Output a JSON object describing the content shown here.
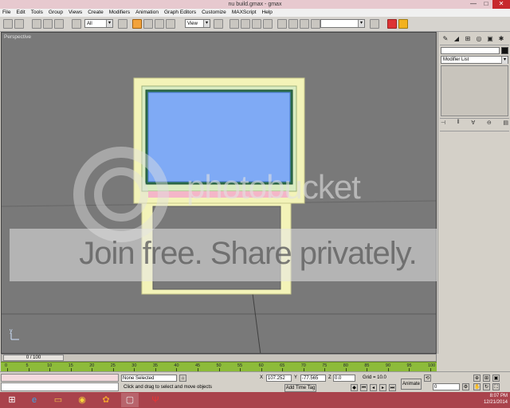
{
  "window": {
    "title": "nu build.gmax - gmax",
    "minimize_glyph": "—",
    "maximize_glyph": "□",
    "close_glyph": "✕"
  },
  "menubar": {
    "items": [
      "File",
      "Edit",
      "Tools",
      "Group",
      "Views",
      "Create",
      "Modifiers",
      "Animation",
      "Graph Editors",
      "Customize",
      "MAXScript",
      "Help"
    ]
  },
  "toolbar": {
    "selection_filter": "All",
    "coord_system": "View"
  },
  "viewport": {
    "label": "Perspective",
    "axis_y": "y",
    "axis_x": "x"
  },
  "command_panel": {
    "modifier_list": "Modifier List"
  },
  "timeline": {
    "slider_label": "0 / 100",
    "ticks": [
      "0",
      "5",
      "10",
      "15",
      "20",
      "25",
      "30",
      "35",
      "40",
      "45",
      "50",
      "55",
      "60",
      "65",
      "70",
      "75",
      "80",
      "85",
      "90",
      "95",
      "100"
    ]
  },
  "status": {
    "selection_text": "None Selected",
    "prompt_text": "Click and drag to select and move objects",
    "x_label": "X",
    "x_value": "107.252",
    "y_label": "Y",
    "y_value": "-77.565",
    "z_label": "Z",
    "z_value": "0.0",
    "grid_text": "Grid = 10.0",
    "add_time_tag": "Add Time Tag",
    "animate_label": "Animate",
    "frame_value": "0"
  },
  "taskbar": {
    "time": "8:07 PM",
    "date": "12/21/2014"
  },
  "watermark": {
    "logo_text": "photobucket",
    "banner_text": "Join free. Share privately."
  },
  "colors": {
    "title_bar": "#e7c9cf",
    "viewport_bg": "#797979",
    "trackbar": "#8dbb3a",
    "taskbar": "#a9434c",
    "frame_yellow": "#f3f3b8",
    "screen_blue": "#7faaf5",
    "pink_strip": "#f4b6c8"
  }
}
